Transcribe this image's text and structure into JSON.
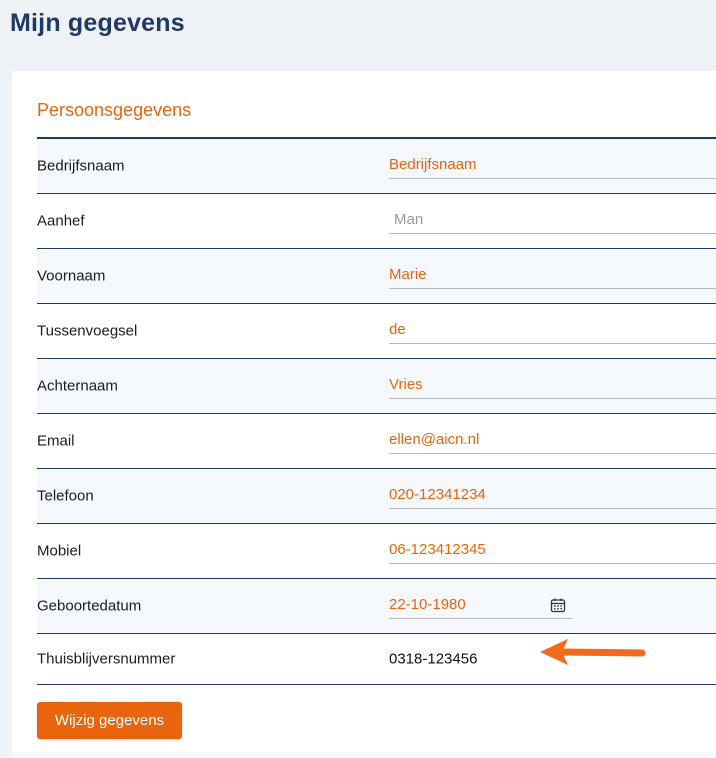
{
  "page": {
    "title": "Mijn gegevens"
  },
  "section": {
    "title": "Persoonsgegevens"
  },
  "fields": [
    {
      "label": "Bedrijfsnaam",
      "value": "Bedrijfsnaam"
    },
    {
      "label": "Aanhef",
      "placeholder": "Man"
    },
    {
      "label": "Voornaam",
      "value": "Marie"
    },
    {
      "label": "Tussenvoegsel",
      "value": "de"
    },
    {
      "label": "Achternaam",
      "value": "Vries"
    },
    {
      "label": "Email",
      "value": "ellen@aicn.nl"
    },
    {
      "label": "Telefoon",
      "value": "020-12341234"
    },
    {
      "label": "Mobiel",
      "value": "06-123412345"
    },
    {
      "label": "Geboortedatum",
      "value": "22-10-1980",
      "icon": "calendar-icon"
    },
    {
      "label": "Thuisblijversnummer",
      "value": "0318-123456"
    }
  ],
  "actions": {
    "submit_label": "Wijzig gegevens"
  },
  "colors": {
    "accent": "#e8650d",
    "heading": "#1f3864",
    "background": "#eef1f6"
  },
  "annotation": {
    "icon": "arrow-left-icon",
    "color": "#f26a1b"
  }
}
